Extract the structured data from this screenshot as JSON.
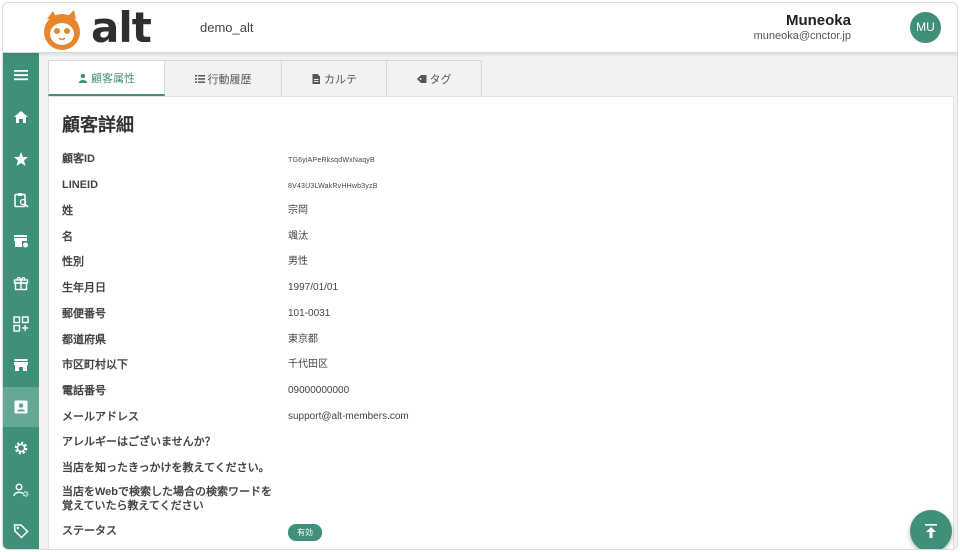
{
  "header": {
    "logo_text": "alt",
    "org_name": "demo_alt",
    "user_name": "Muneoka",
    "user_email": "muneoka@cnctor.jp",
    "avatar_initials": "MU"
  },
  "colors": {
    "accent": "#3f8f7b",
    "logo_orange": "#e8862e"
  },
  "sidebar": {
    "items": [
      {
        "icon": "menu-icon"
      },
      {
        "icon": "home-icon"
      },
      {
        "icon": "star-icon"
      },
      {
        "icon": "clipboard-search-icon"
      },
      {
        "icon": "store-badge-icon"
      },
      {
        "icon": "gift-icon"
      },
      {
        "icon": "qr-add-icon"
      },
      {
        "icon": "storefront-icon"
      },
      {
        "icon": "contact-card-icon",
        "active": true
      },
      {
        "icon": "gear-icon"
      },
      {
        "icon": "user-settings-icon"
      },
      {
        "icon": "tag-icon"
      }
    ]
  },
  "tabs": [
    {
      "label": "顧客属性",
      "icon": "person-icon",
      "active": true
    },
    {
      "label": "行動履歴",
      "icon": "list-icon"
    },
    {
      "label": "カルテ",
      "icon": "document-icon"
    },
    {
      "label": "タグ",
      "icon": "tag-icon"
    }
  ],
  "detail": {
    "title": "顧客詳細",
    "fields": [
      {
        "label": "顧客ID",
        "value": "TG6yiAPeRksqdWxNaqyB"
      },
      {
        "label": "LINEID",
        "value": "8V43U3LWakRvHHwb3yzB"
      },
      {
        "label": "姓",
        "value": "宗岡"
      },
      {
        "label": "名",
        "value": "颯汰"
      },
      {
        "label": "性別",
        "value": "男性"
      },
      {
        "label": "生年月日",
        "value": "1997/01/01"
      },
      {
        "label": "郵便番号",
        "value": "101-0031"
      },
      {
        "label": "都道府県",
        "value": "東京都"
      },
      {
        "label": "市区町村以下",
        "value": "千代田区"
      },
      {
        "label": "電話番号",
        "value": "09000000000"
      },
      {
        "label": "メールアドレス",
        "value": "support@alt-members.com"
      },
      {
        "label": "アレルギーはございませんか？",
        "value": ""
      },
      {
        "label": "当店を知ったきっかけを教えてください。",
        "value": ""
      },
      {
        "label": "当店をWebで検索した場合の検索ワードを覚えていたら教えてください",
        "value": ""
      }
    ],
    "status_label": "ステータス",
    "status_value": "有効"
  }
}
